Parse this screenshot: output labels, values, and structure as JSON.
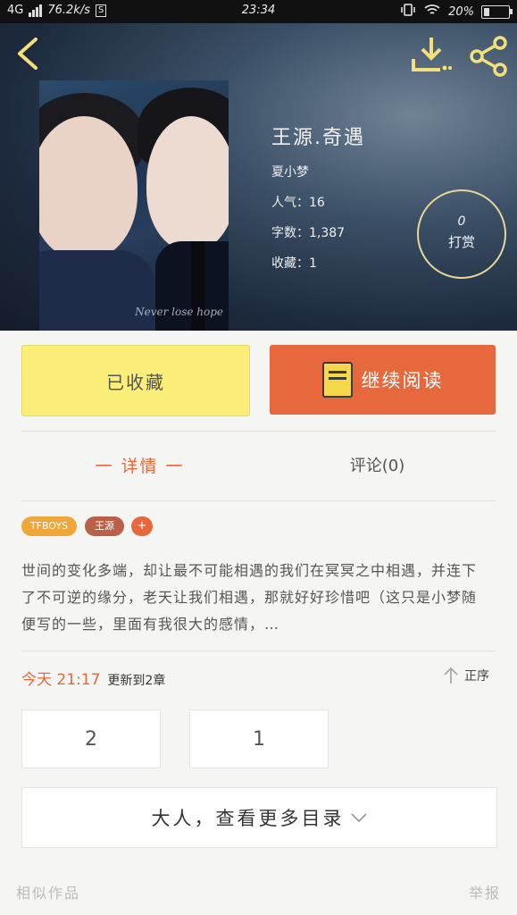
{
  "status": {
    "network": "4G",
    "speed": "76.2k/s",
    "s_badge": "S",
    "time": "23:34",
    "battery": "20%",
    "battery_level": 0.2
  },
  "book": {
    "title": "王源.奇遇",
    "author": "夏小梦",
    "popularity": "人气：16",
    "word_count": "字数：1,387",
    "favorites": "收藏：1",
    "cover_caption": "Never lose hope"
  },
  "reward": {
    "count": "0",
    "label": "打赏"
  },
  "actions": {
    "favorited": "已收藏",
    "continue": "继续阅读"
  },
  "tabs": {
    "detail": "一 详情 一",
    "comments": "评论(0)"
  },
  "tags": [
    "TFBOYS",
    "王源",
    "+"
  ],
  "description": "世间的变化多端，却让最不可能相遇的我们在冥冥之中相遇，并连下了不可逆的缘分，老天让我们相遇，那就好好珍惜吧（这只是小梦随便写的一些，里面有我很大的感情，…",
  "update": {
    "time": "今天 21:17",
    "text": "更新到2章"
  },
  "order_label": "正序",
  "chapters": [
    "2",
    "1"
  ],
  "more_catalog": "大人，查看更多目录",
  "footer": {
    "similar": "相似作品",
    "report": "举报"
  },
  "colors": {
    "accent": "#e8683d",
    "favorite_bg": "#fbef79",
    "icon_yellow": "#f2e07a"
  }
}
